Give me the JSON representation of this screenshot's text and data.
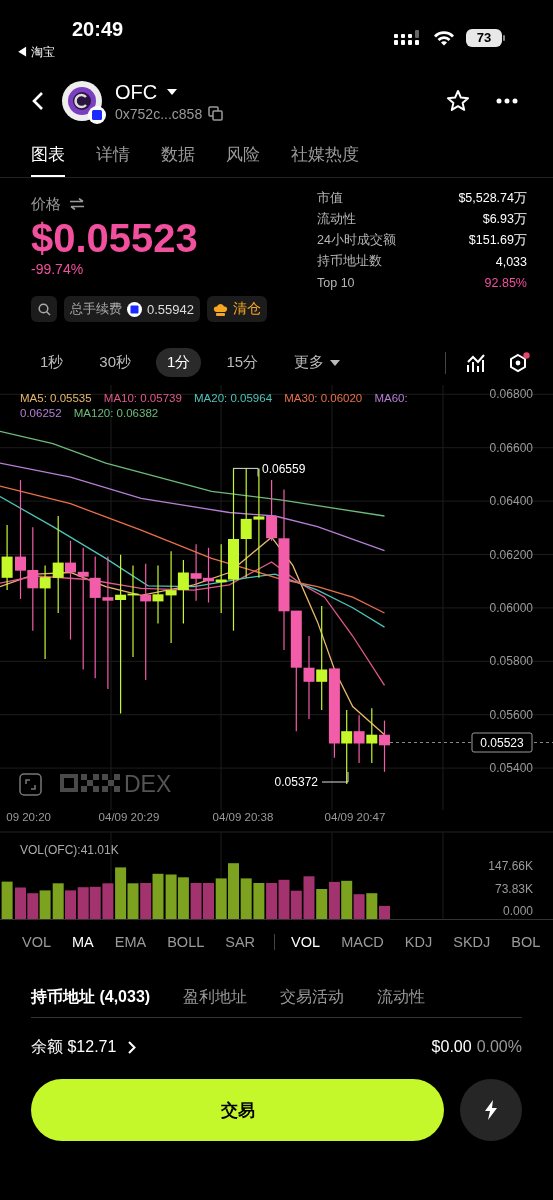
{
  "status_bar": {
    "time": "20:49",
    "back_app": "◀ 淘宝",
    "battery": "73"
  },
  "token": {
    "symbol": "OFC",
    "address": "0x752c...c858"
  },
  "tabs": [
    {
      "label": "图表",
      "selected": true
    },
    {
      "label": "详情",
      "selected": false
    },
    {
      "label": "数据",
      "selected": false
    },
    {
      "label": "风险",
      "selected": false
    },
    {
      "label": "社媒热度",
      "selected": false
    }
  ],
  "price": {
    "label": "价格",
    "value": "$0.05523",
    "change": "-99.74%"
  },
  "stats": [
    {
      "label": "市值",
      "value": "$5,528.74万",
      "kind": "plain"
    },
    {
      "label": "流动性",
      "value": "$6.93万",
      "kind": "plain"
    },
    {
      "label": "24小时成交额",
      "value": "$151.69万",
      "kind": "plain"
    },
    {
      "label": "持币地址数",
      "value": "4,033",
      "kind": "plain"
    },
    {
      "label": "Top 10",
      "value": "92.85%",
      "kind": "highlight"
    }
  ],
  "chips": {
    "fee_label": "总手续费",
    "fee_value": "0.55942",
    "clear_label": "清仓"
  },
  "intervals": [
    {
      "label": "1秒",
      "selected": false,
      "kind": "option"
    },
    {
      "label": "30秒",
      "selected": false,
      "kind": "option"
    },
    {
      "label": "1分",
      "selected": true,
      "kind": "option"
    },
    {
      "label": "15分",
      "selected": false,
      "kind": "option"
    },
    {
      "label": "更多",
      "selected": false,
      "kind": "menu"
    }
  ],
  "chart": {
    "ma_legend": [
      {
        "label": "MA5: 0.05535",
        "color": "#e8b86d"
      },
      {
        "label": "MA10: 0.05739",
        "color": "#e0588c"
      },
      {
        "label": "MA20: 0.05964",
        "color": "#4fc3b8"
      },
      {
        "label": "MA30: 0.06020",
        "color": "#e8704a"
      },
      {
        "label": "MA60: 0.06252",
        "color": "#b67fd6"
      },
      {
        "label": "MA120: 0.06382",
        "color": "#6dbb7a"
      }
    ],
    "price_ticks": [
      "0.06800",
      "0.06600",
      "0.06400",
      "0.06200",
      "0.06000",
      "0.05800",
      "0.05600",
      "0.05400"
    ],
    "current_price": "0.05523",
    "high_label": "0.06559",
    "low_label": "0.05372",
    "time_labels": [
      "09 20:20",
      "04/09 20:29",
      "04/09 20:38",
      "04/09 20:47"
    ],
    "watermark": "DEX"
  },
  "volume": {
    "label": "VOL(OFC):41.01K",
    "ticks": [
      "147.66K",
      "73.83K",
      "0.000"
    ]
  },
  "indicators": {
    "main": [
      {
        "label": "VOL",
        "selected": false
      },
      {
        "label": "MA",
        "selected": true
      },
      {
        "label": "EMA",
        "selected": false
      },
      {
        "label": "BOLL",
        "selected": false
      },
      {
        "label": "SAR",
        "selected": false
      }
    ],
    "sub": [
      {
        "label": "VOL",
        "selected": true
      },
      {
        "label": "MACD",
        "selected": false
      },
      {
        "label": "KDJ",
        "selected": false
      },
      {
        "label": "SKDJ",
        "selected": false
      },
      {
        "label": "BOL",
        "selected": false
      }
    ]
  },
  "holder_tabs": [
    {
      "label": "持币地址 (4,033)",
      "selected": true
    },
    {
      "label": "盈利地址",
      "selected": false
    },
    {
      "label": "交易活动",
      "selected": false
    },
    {
      "label": "流动性",
      "selected": false
    }
  ],
  "balance": {
    "label": "余额 $12.71",
    "value": "$0.00",
    "percent": "0.00%"
  },
  "trade_button": "交易"
}
